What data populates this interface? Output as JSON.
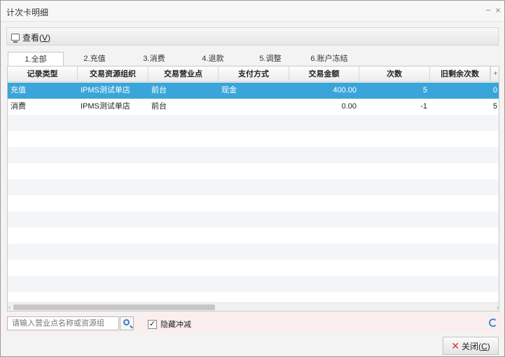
{
  "window": {
    "title": "计次卡明细",
    "minimize_glyph": "−",
    "close_glyph": "×"
  },
  "toolbar": {
    "view_label": "查看(",
    "view_key": "V",
    "view_suffix": ")"
  },
  "tabs": [
    "1.全部",
    "2.充值",
    "3.消费",
    "4.退款",
    "5.调整",
    "6.账户冻结"
  ],
  "table": {
    "headers": [
      "记录类型",
      "交易资源组织",
      "交易营业点",
      "支付方式",
      "交易金额",
      "次数",
      "旧剩余次数"
    ],
    "rows": [
      [
        "充值",
        "IPMS测试单店",
        "前台",
        "现金",
        "400.00",
        "5",
        "0"
      ],
      [
        "消费",
        "IPMS测试单店",
        "前台",
        "",
        "0.00",
        "-1",
        "5"
      ]
    ]
  },
  "filter": {
    "search_placeholder": "请输入营业点名称或资源组",
    "hide_offset_label": "隐藏冲减",
    "hide_offset_checked": true,
    "check_glyph": "✓"
  },
  "footer": {
    "close_label": "关闭(",
    "close_key": "C",
    "close_suffix": ")",
    "close_glyph": "✕"
  },
  "icons": {
    "view": "monitor-icon",
    "search": "search-icon",
    "refresh": "refresh-icon",
    "close": "close-icon"
  },
  "colors": {
    "selected_row": "#3aa5d9",
    "filter_bar": "#fbeeee",
    "close_x": "#d6322a",
    "accent": "#3b7dc4"
  }
}
